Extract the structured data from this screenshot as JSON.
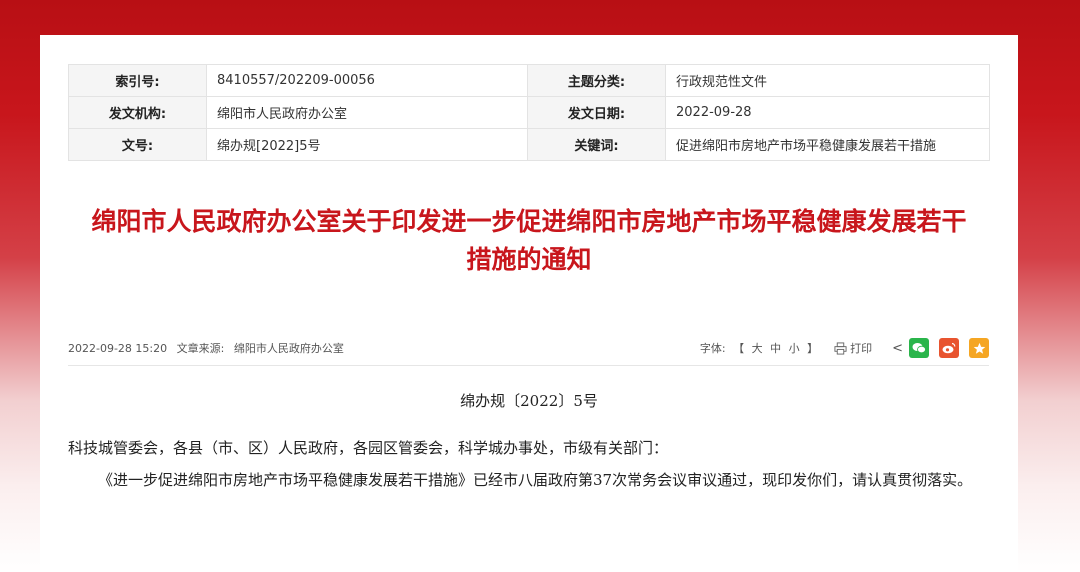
{
  "meta": {
    "index_label": "索引号:",
    "index_value": "8410557/202209-00056",
    "category_label": "主题分类:",
    "category_value": "行政规范性文件",
    "issuer_label": "发文机构:",
    "issuer_value": "绵阳市人民政府办公室",
    "date_label": "发文日期:",
    "date_value": "2022-09-28",
    "docno_label": "文号:",
    "docno_value": "绵办规[2022]5号",
    "keywords_label": "关键词:",
    "keywords_value": "促进绵阳市房地产市场平稳健康发展若干措施"
  },
  "title": {
    "line1": "绵阳市人民政府办公室关于印发进一步促进绵阳市房地产市场平稳健康发展若干",
    "line2": "措施的通知"
  },
  "infobar": {
    "datetime": "2022-09-28 15:20",
    "source_label": "文章来源:",
    "source_value": "绵阳市人民政府办公室",
    "font_label": "字体:",
    "bracket_open": "【",
    "font_large": "大",
    "font_medium": "中",
    "font_small": "小",
    "bracket_close": "】",
    "print_label": "打印",
    "share_symbol": "<"
  },
  "body": {
    "doc_number": "绵办规〔2022〕5号",
    "recipients": "科技城管委会，各县（市、区）人民政府，各园区管委会，科学城办事处，市级有关部门：",
    "paragraph1": "《进一步促进绵阳市房地产市场平稳健康发展若干措施》已经市八届政府第37次常务会议审议通过，现印发你们，请认真贯彻落实。"
  },
  "colors": {
    "title_red": "#c8161c",
    "wechat_green": "#2ab54b",
    "weibo_orange": "#e8542f",
    "favorite_yellow": "#f5a623"
  }
}
